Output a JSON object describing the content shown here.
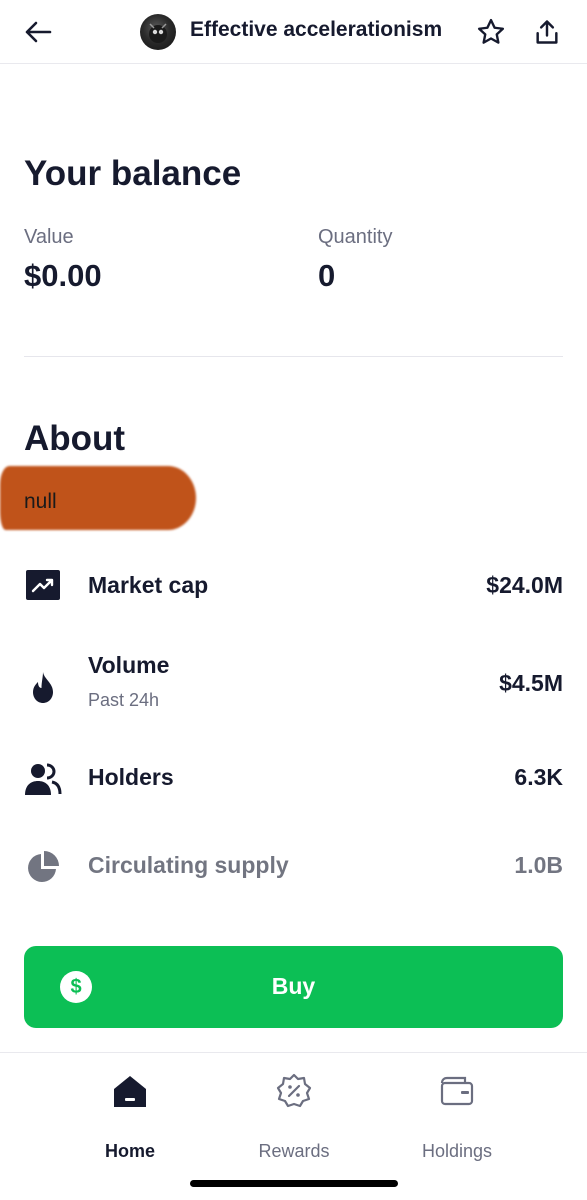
{
  "header": {
    "title": "Effective accelerationism",
    "back_icon": "arrow-left-icon",
    "favorite_icon": "star-icon",
    "share_icon": "share-icon"
  },
  "balance": {
    "title": "Your balance",
    "value_label": "Value",
    "value": "$0.00",
    "quantity_label": "Quantity",
    "quantity": "0"
  },
  "about": {
    "title": "About",
    "description": "null",
    "highlight_color": "#c0531a"
  },
  "stats": [
    {
      "icon": "trending-up-icon",
      "label": "Market cap",
      "sublabel": "",
      "value": "$24.0M"
    },
    {
      "icon": "flame-icon",
      "label": "Volume",
      "sublabel": "Past 24h",
      "value": "$4.5M"
    },
    {
      "icon": "users-icon",
      "label": "Holders",
      "sublabel": "",
      "value": "6.3K"
    },
    {
      "icon": "pie-chart-icon",
      "label": "Circulating supply",
      "sublabel": "",
      "value": "1.0B"
    }
  ],
  "buy": {
    "label": "Buy",
    "icon": "dollar-icon",
    "color": "#0cbf55"
  },
  "nav": {
    "items": [
      {
        "label": "Home",
        "icon": "home-icon",
        "active": true
      },
      {
        "label": "Rewards",
        "icon": "rewards-badge-icon",
        "active": false
      },
      {
        "label": "Holdings",
        "icon": "wallet-icon",
        "active": false
      }
    ]
  },
  "colors": {
    "text_primary": "#161a2e",
    "text_secondary": "#6b6e80"
  }
}
